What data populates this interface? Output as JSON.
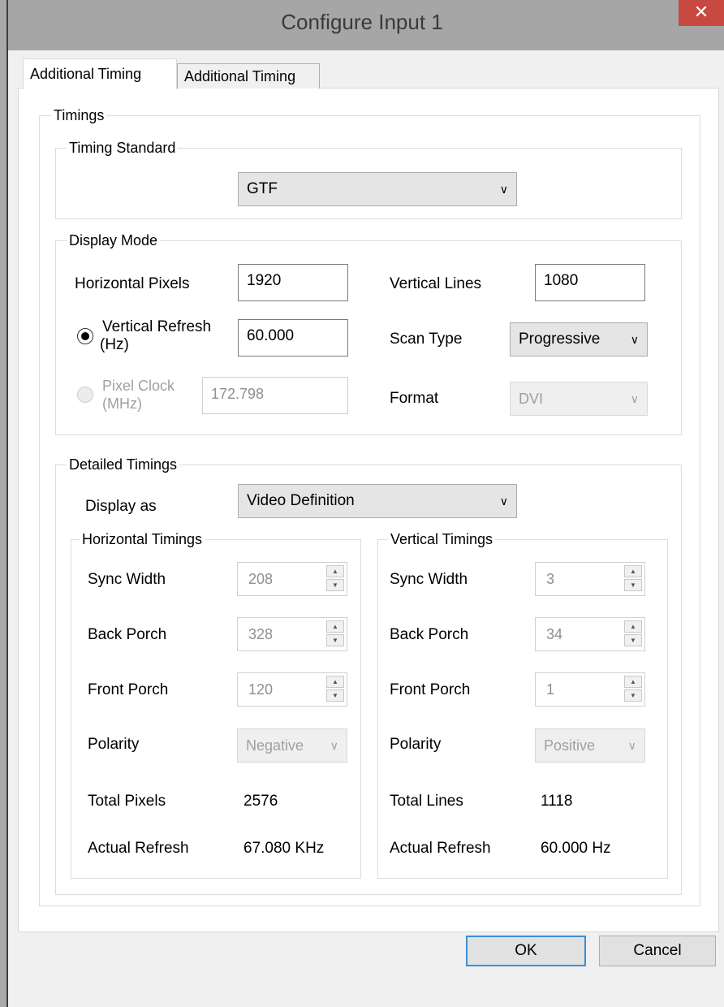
{
  "window": {
    "title": "Configure Input 1",
    "close_glyph": "✕"
  },
  "tabs": [
    {
      "label": "Additional Timing",
      "active": true
    },
    {
      "label": "Additional Timing",
      "active": false
    }
  ],
  "timings": {
    "label": "Timings",
    "timing_standard": {
      "label": "Timing Standard",
      "value": "GTF"
    },
    "display_mode": {
      "label": "Display Mode",
      "horizontal_pixels": {
        "label": "Horizontal Pixels",
        "value": "1920"
      },
      "vertical_lines": {
        "label": "Vertical Lines",
        "value": "1080"
      },
      "vertical_refresh": {
        "label_line1": "Vertical Refresh",
        "label_line2": "(Hz)",
        "value": "60.000",
        "selected": true
      },
      "pixel_clock": {
        "label_line1": "Pixel Clock",
        "label_line2": "(MHz)",
        "value": "172.798",
        "enabled": false
      },
      "scan_type": {
        "label": "Scan Type",
        "value": "Progressive"
      },
      "format": {
        "label": "Format",
        "value": "DVI",
        "enabled": false
      }
    },
    "detailed": {
      "label": "Detailed Timings",
      "display_as": {
        "label": "Display as",
        "value": "Video Definition"
      },
      "horizontal": {
        "label": "Horizontal Timings",
        "sync_width": {
          "label": "Sync Width",
          "value": "208"
        },
        "back_porch": {
          "label": "Back Porch",
          "value": "328"
        },
        "front_porch": {
          "label": "Front Porch",
          "value": "120"
        },
        "polarity": {
          "label": "Polarity",
          "value": "Negative"
        },
        "total": {
          "label": "Total Pixels",
          "value": "2576"
        },
        "actual_refresh": {
          "label": "Actual Refresh",
          "value": "67.080 KHz"
        }
      },
      "vertical": {
        "label": "Vertical Timings",
        "sync_width": {
          "label": "Sync Width",
          "value": "3"
        },
        "back_porch": {
          "label": "Back Porch",
          "value": "34"
        },
        "front_porch": {
          "label": "Front Porch",
          "value": "1"
        },
        "polarity": {
          "label": "Polarity",
          "value": "Positive"
        },
        "total": {
          "label": "Total Lines",
          "value": "1118"
        },
        "actual_refresh": {
          "label": "Actual Refresh",
          "value": "60.000 Hz"
        }
      }
    }
  },
  "buttons": {
    "ok": "OK",
    "cancel": "Cancel"
  },
  "icons": {
    "chevron": "chevron-down-icon",
    "spin_up": "▲",
    "spin_down": "▼"
  },
  "colors": {
    "close_button": "#c7493f",
    "default_button_border": "#3c8fd6"
  }
}
